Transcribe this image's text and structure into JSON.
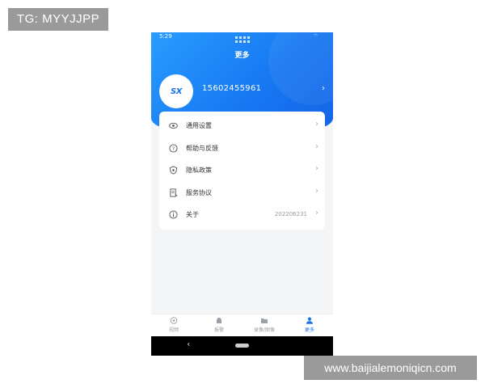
{
  "watermarks": {
    "top_left": "TG: MYYJJPP",
    "bottom_right": "www.baijialemoniqicn.com"
  },
  "status_bar": {
    "time": "5:29"
  },
  "header": {
    "title": "更多"
  },
  "user": {
    "avatar_logo": "SX",
    "phone": "15602455961"
  },
  "menu": {
    "items": [
      {
        "label": "通用设置",
        "icon": "eye-icon",
        "value": ""
      },
      {
        "label": "帮助与反馈",
        "icon": "help-circle-icon",
        "value": ""
      },
      {
        "label": "隐私政策",
        "icon": "shield-icon",
        "value": ""
      },
      {
        "label": "服务协议",
        "icon": "document-icon",
        "value": ""
      },
      {
        "label": "关于",
        "icon": "info-icon",
        "value": "202206231"
      }
    ]
  },
  "tabs": [
    {
      "label": "视频",
      "icon": "video-icon",
      "active": false
    },
    {
      "label": "报警",
      "icon": "alarm-icon",
      "active": false
    },
    {
      "label": "录像/图像",
      "icon": "folder-icon",
      "active": false
    },
    {
      "label": "更多",
      "icon": "person-icon",
      "active": true
    }
  ],
  "colors": {
    "primary": "#1a73e8",
    "header_gradient_start": "#2a9cff",
    "header_gradient_end": "#1565e6",
    "background": "#f4f5f7"
  }
}
